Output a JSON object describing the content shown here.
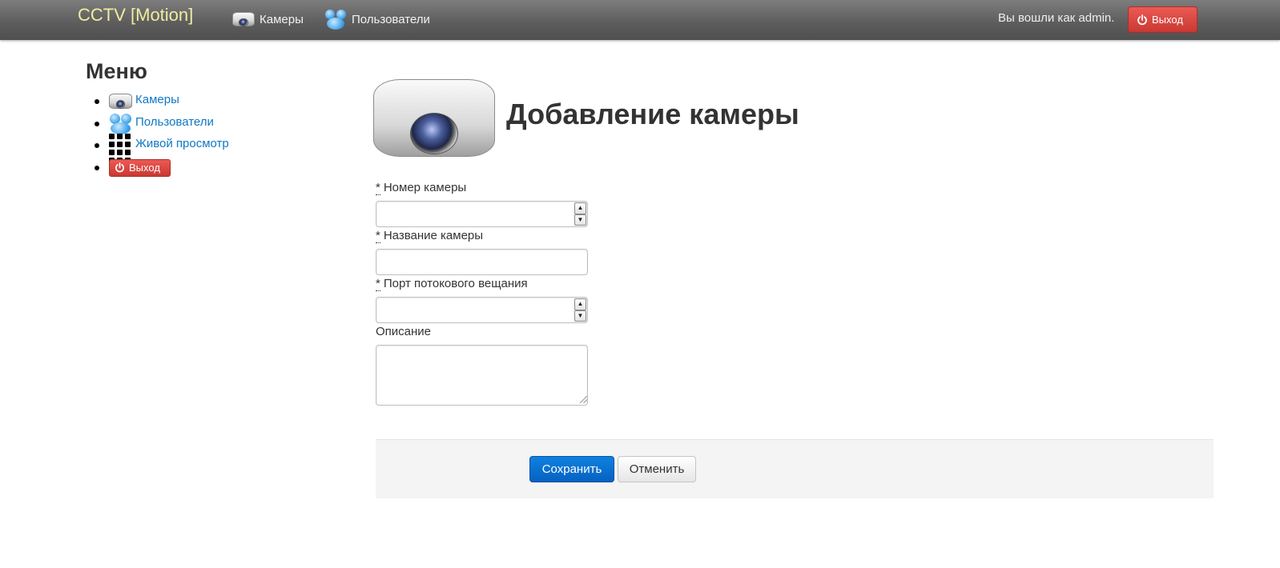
{
  "navbar": {
    "brand": "CCTV [Motion]",
    "cameras_label": "Камеры",
    "users_label": "Пользователи",
    "logged_in_text": "Вы вошли как admin.",
    "logout_label": "Выход"
  },
  "sidebar": {
    "title": "Меню",
    "items": [
      {
        "label": "Камеры",
        "icon": "camera-icon"
      },
      {
        "label": "Пользователи",
        "icon": "users-icon"
      },
      {
        "label": "Живой просмотр",
        "icon": "grid-icon"
      },
      {
        "label": "Выход",
        "icon": "power-icon"
      }
    ]
  },
  "main": {
    "title": "Добавление камеры",
    "required_mark": "*",
    "fields": {
      "camera_number": {
        "label": "Номер камеры",
        "value": ""
      },
      "camera_name": {
        "label": "Название камеры",
        "value": ""
      },
      "stream_port": {
        "label": "Порт потокового вещания",
        "value": ""
      },
      "description": {
        "label": "Описание",
        "value": ""
      }
    },
    "save_label": "Сохранить",
    "cancel_label": "Отменить"
  },
  "colors": {
    "brand": "#f1eca0",
    "link": "#0f78c5",
    "danger": "#c93833",
    "primary": "#0661c2"
  }
}
